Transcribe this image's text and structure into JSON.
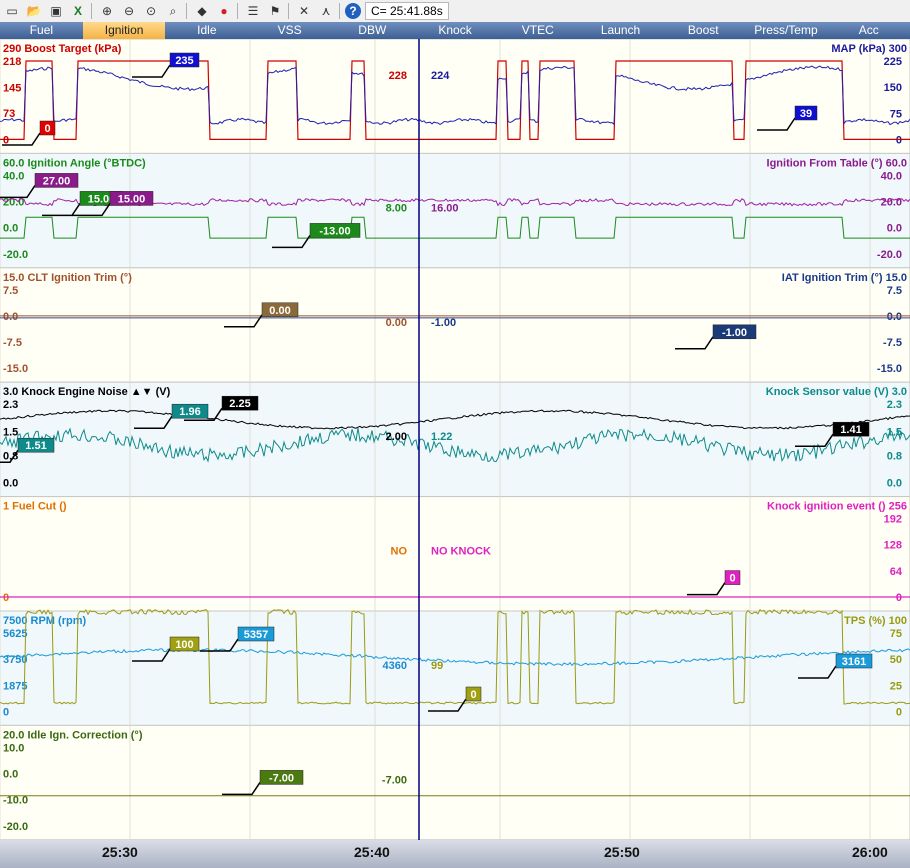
{
  "toolbar": {
    "icons": [
      "folder-icon",
      "open-icon",
      "save-icon",
      "excel-icon",
      "zoom-in-icon",
      "zoom-out-icon",
      "zoom-fit-icon",
      "zoom-window-icon",
      "eraser-icon",
      "record-icon",
      "list-icon",
      "flag-icon",
      "tools-icon",
      "graph-icon",
      "help-icon"
    ],
    "cursor_time": "C= 25:41.88s"
  },
  "tabs": [
    {
      "label": "Fuel",
      "active": false
    },
    {
      "label": "Ignition",
      "active": true
    },
    {
      "label": "Idle",
      "active": false
    },
    {
      "label": "VSS",
      "active": false
    },
    {
      "label": "DBW",
      "active": false
    },
    {
      "label": "Knock",
      "active": false
    },
    {
      "label": "VTEC",
      "active": false
    },
    {
      "label": "Launch",
      "active": false
    },
    {
      "label": "Boost",
      "active": false
    },
    {
      "label": "Press/Temp",
      "active": false
    },
    {
      "label": "Acc",
      "active": false
    }
  ],
  "time_axis": [
    "25:30",
    "25:40",
    "25:50",
    "26:00"
  ],
  "cursor_value_labels": true,
  "panels": [
    {
      "id": "boost",
      "left_title": "290 Boost Target (kPa)",
      "left_color": "#cc0000",
      "right_title": "MAP (kPa) 300",
      "right_color": "#1a1aa0",
      "left_ticks": [
        {
          "v": 218,
          "t": "218"
        },
        {
          "v": 145,
          "t": "145"
        },
        {
          "v": 73,
          "t": "73"
        },
        {
          "v": 0,
          "t": "0"
        }
      ],
      "right_ticks": [
        {
          "v": 225,
          "t": "225"
        },
        {
          "v": 150,
          "t": "150"
        },
        {
          "v": 75,
          "t": "75"
        },
        {
          "v": 0,
          "t": "0"
        }
      ],
      "left_max": 290,
      "right_max": 300,
      "cursor_left": {
        "text": "228",
        "color": "#cc0000"
      },
      "cursor_right": {
        "text": "224",
        "color": "#1a1aa0"
      },
      "flags": [
        {
          "text": "0",
          "bg": "#e00000",
          "color": "#fff",
          "side": "left-axis"
        },
        {
          "text": "235",
          "bg": "#1010d0",
          "color": "#fff"
        },
        {
          "text": "39",
          "bg": "#1010d0",
          "color": "#fff"
        }
      ]
    },
    {
      "id": "ignition",
      "left_title": "60.0 Ignition Angle (°BTDC)",
      "left_color": "#1a8a1a",
      "right_title": "Ignition From Table (°) 60.0",
      "right_color": "#8b1a8b",
      "left_ticks": [
        {
          "v": 40,
          "t": "40.0"
        },
        {
          "v": 20,
          "t": "20.0"
        },
        {
          "v": 0,
          "t": "0.0"
        },
        {
          "v": -20,
          "t": "-20.0"
        }
      ],
      "right_ticks": [
        {
          "v": 40,
          "t": "40.0"
        },
        {
          "v": 20,
          "t": "20.0"
        },
        {
          "v": 0,
          "t": "0.0"
        },
        {
          "v": -20,
          "t": "-20.0"
        }
      ],
      "cursor_left": {
        "text": "8.00",
        "color": "#1a8a1a"
      },
      "cursor_right": {
        "text": "16.00",
        "color": "#8b1a8b"
      },
      "flags": [
        {
          "text": "27.00",
          "bg": "#8b1a8b",
          "color": "#fff"
        },
        {
          "text": "15.00",
          "bg": "#1a8a1a",
          "color": "#fff"
        },
        {
          "text": "15.00",
          "bg": "#8b1a8b",
          "color": "#fff"
        },
        {
          "text": "-13.00",
          "bg": "#1a8a1a",
          "color": "#fff"
        }
      ]
    },
    {
      "id": "trim",
      "left_title": "15.0 CLT Ignition Trim (°)",
      "left_color": "#a0522d",
      "right_title": "IAT Ignition Trim (°) 15.0",
      "right_color": "#1a3a8a",
      "left_ticks": [
        {
          "v": 7.5,
          "t": "7.5"
        },
        {
          "v": 0,
          "t": "0.0"
        },
        {
          "v": -7.5,
          "t": "-7.5"
        },
        {
          "v": -15,
          "t": "-15.0"
        }
      ],
      "right_ticks": [
        {
          "v": 7.5,
          "t": "7.5"
        },
        {
          "v": 0,
          "t": "0.0"
        },
        {
          "v": -7.5,
          "t": "-7.5"
        },
        {
          "v": -15,
          "t": "-15.0"
        }
      ],
      "cursor_left": {
        "text": "0.00",
        "color": "#a0522d"
      },
      "cursor_right": {
        "text": "-1.00",
        "color": "#1a3a8a"
      },
      "flags": [
        {
          "text": "0.00",
          "bg": "#8a6a3a",
          "color": "#fff"
        },
        {
          "text": "-1.00",
          "bg": "#1a3a7a",
          "color": "#fff"
        }
      ]
    },
    {
      "id": "knock",
      "left_title": "3.0 Knock Engine Noise ▲▼ (V)",
      "left_color": "#000000",
      "right_title": "Knock Sensor value (V) 3.0",
      "right_color": "#0f8a8a",
      "left_ticks": [
        {
          "v": 2.3,
          "t": "2.3"
        },
        {
          "v": 1.5,
          "t": "1.5"
        },
        {
          "v": 0.8,
          "t": "0.8"
        },
        {
          "v": 0,
          "t": "0.0"
        }
      ],
      "right_ticks": [
        {
          "v": 2.3,
          "t": "2.3"
        },
        {
          "v": 1.5,
          "t": "1.5"
        },
        {
          "v": 0.8,
          "t": "0.8"
        },
        {
          "v": 0,
          "t": "0.0"
        }
      ],
      "cursor_left": {
        "text": "2.00",
        "color": "#000000"
      },
      "cursor_right": {
        "text": "1.22",
        "color": "#0f8a8a"
      },
      "flags": [
        {
          "text": "1.51",
          "bg": "#0f8a8a",
          "color": "#fff",
          "side": "left-axis"
        },
        {
          "text": "1.96",
          "bg": "#0f8a8a",
          "color": "#fff"
        },
        {
          "text": "2.25",
          "bg": "#000000",
          "color": "#fff"
        },
        {
          "text": "1.41",
          "bg": "#000000",
          "color": "#fff"
        }
      ]
    },
    {
      "id": "fuelcut",
      "left_title": "1 Fuel Cut ()",
      "left_color": "#e07000",
      "right_title": "Knock ignition event () 256",
      "right_color": "#e020c0",
      "left_ticks": [
        {
          "v": 0,
          "t": "0"
        }
      ],
      "right_ticks": [
        {
          "v": 192,
          "t": "192"
        },
        {
          "v": 128,
          "t": "128"
        },
        {
          "v": 64,
          "t": "64"
        },
        {
          "v": 0,
          "t": "0"
        }
      ],
      "cursor_left": {
        "text": "NO",
        "color": "#e07000"
      },
      "cursor_right": {
        "text": "NO KNOCK",
        "color": "#e020c0"
      },
      "flags": [
        {
          "text": "0",
          "bg": "#e020c0",
          "color": "#fff"
        }
      ]
    },
    {
      "id": "rpm",
      "left_title": "7500 RPM (rpm)",
      "left_color": "#1a8acf",
      "right_title": "TPS (%) 100",
      "right_color": "#9a9a10",
      "left_ticks": [
        {
          "v": 5625,
          "t": "5625"
        },
        {
          "v": 3750,
          "t": "3750"
        },
        {
          "v": 1875,
          "t": "1875"
        },
        {
          "v": 0,
          "t": "0"
        }
      ],
      "right_ticks": [
        {
          "v": 75,
          "t": "75"
        },
        {
          "v": 50,
          "t": "50"
        },
        {
          "v": 25,
          "t": "25"
        },
        {
          "v": 0,
          "t": "0"
        }
      ],
      "cursor_left": {
        "text": "4360",
        "color": "#1a8acf"
      },
      "cursor_right": {
        "text": "99",
        "color": "#9a9a10"
      },
      "flags": [
        {
          "text": "100",
          "bg": "#a0a010",
          "color": "#fff"
        },
        {
          "text": "5357",
          "bg": "#1a9ad8",
          "color": "#fff"
        },
        {
          "text": "0",
          "bg": "#a0a010",
          "color": "#fff"
        },
        {
          "text": "3161",
          "bg": "#1a9ad8",
          "color": "#fff"
        }
      ]
    },
    {
      "id": "idle",
      "left_title": "20.0 Idle Ign. Correction (°)",
      "left_color": "#3a6a10",
      "right_title": "",
      "right_color": "#3a6a10",
      "left_ticks": [
        {
          "v": 10,
          "t": "10.0"
        },
        {
          "v": 0,
          "t": "0.0"
        },
        {
          "v": -10,
          "t": "-10.0"
        },
        {
          "v": -20,
          "t": "-20.0"
        }
      ],
      "right_ticks": [],
      "cursor_left": {
        "text": "-7.00",
        "color": "#3a6a10"
      },
      "cursor_right": {
        "text": "",
        "color": "#3a6a10"
      },
      "flags": [
        {
          "text": "-7.00",
          "bg": "#4a7a10",
          "color": "#fff"
        }
      ]
    }
  ],
  "colors": {
    "plot_bg": "#fffff6",
    "plot_bg_alt": "#f0f8fc",
    "grid": "#e0e0d4",
    "cursor": "#000080",
    "tab_active": "#f5b345"
  }
}
